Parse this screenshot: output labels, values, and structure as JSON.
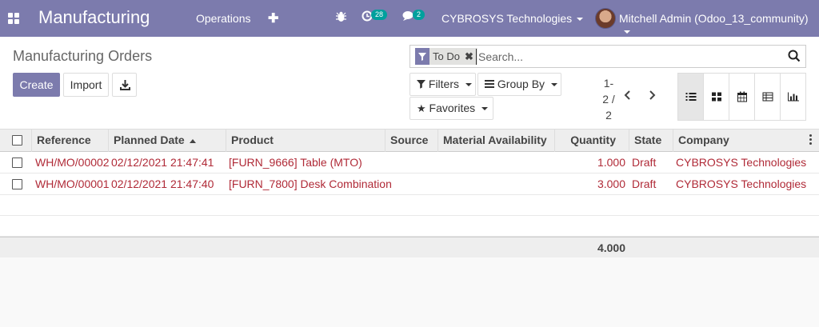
{
  "navbar": {
    "brand": "Manufacturing",
    "menu_operations": "Operations",
    "activity_count": "28",
    "message_count": "2",
    "company": "CYBROSYS Technologies",
    "user": "Mitchell Admin (Odoo_13_community)"
  },
  "control_panel": {
    "breadcrumb": "Manufacturing Orders",
    "create_label": "Create",
    "import_label": "Import",
    "search": {
      "facet": "To Do",
      "placeholder": "Search..."
    },
    "filters_label": "Filters",
    "groupby_label": "Group By",
    "favorites_label": "Favorites",
    "pager": {
      "range": "1-",
      "value": "2 /",
      "total": "2"
    }
  },
  "table": {
    "columns": [
      "Reference",
      "Planned Date",
      "Product",
      "Source",
      "Material Availability",
      "Quantity",
      "State",
      "Company"
    ],
    "sorted_column": "Planned Date",
    "rows": [
      {
        "reference": "WH/MO/00002",
        "planned_date": "02/12/2021 21:47:41",
        "product": "[FURN_9666] Table (MTO)",
        "source": "",
        "material_availability": "",
        "quantity": "1.000",
        "state": "Draft",
        "company": "CYBROSYS Technologies"
      },
      {
        "reference": "WH/MO/00001",
        "planned_date": "02/12/2021 21:47:40",
        "product": "[FURN_7800] Desk Combination",
        "source": "",
        "material_availability": "",
        "quantity": "3.000",
        "state": "Draft",
        "company": "CYBROSYS Technologies"
      }
    ],
    "total_quantity": "4.000"
  },
  "colors": {
    "brand": "#7c7bad",
    "badge": "#00a09d",
    "row_text": "#b02a37"
  }
}
